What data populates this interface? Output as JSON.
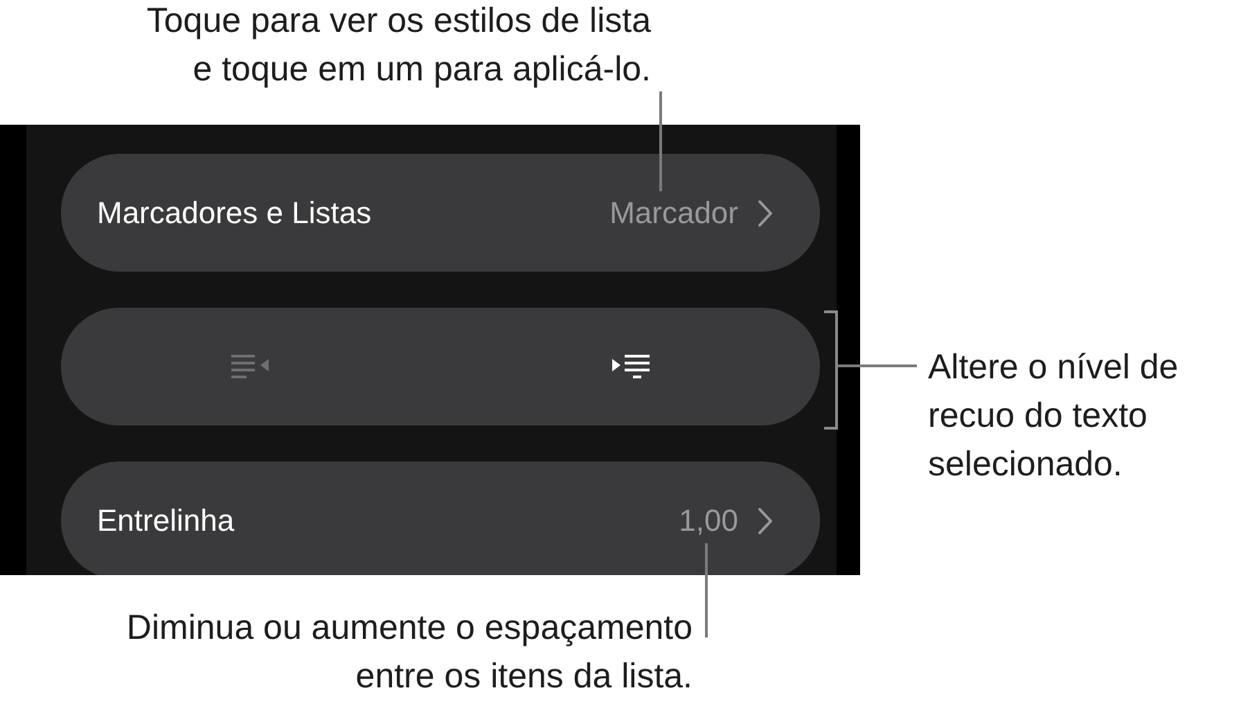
{
  "callouts": [
    {
      "kind": "top",
      "lines": [
        "Toque para ver os estilos de lista",
        "e toque em um para aplicá-lo."
      ]
    },
    {
      "kind": "right",
      "lines": [
        "Altere o nível de",
        "recuo do texto",
        "selecionado."
      ]
    },
    {
      "kind": "bottom",
      "lines": [
        "Diminua ou aumente o espaçamento",
        "entre os itens da lista."
      ]
    }
  ],
  "rows": [
    {
      "kind": "setting",
      "label": "Marcadores e Listas",
      "value": "Marcador"
    },
    {
      "kind": "indent",
      "buttons": [
        {
          "kind": "decrease",
          "disabled": true
        },
        {
          "kind": "increase",
          "disabled": false
        }
      ]
    },
    {
      "kind": "setting",
      "label": "Entrelinha",
      "value": "1,00"
    }
  ]
}
